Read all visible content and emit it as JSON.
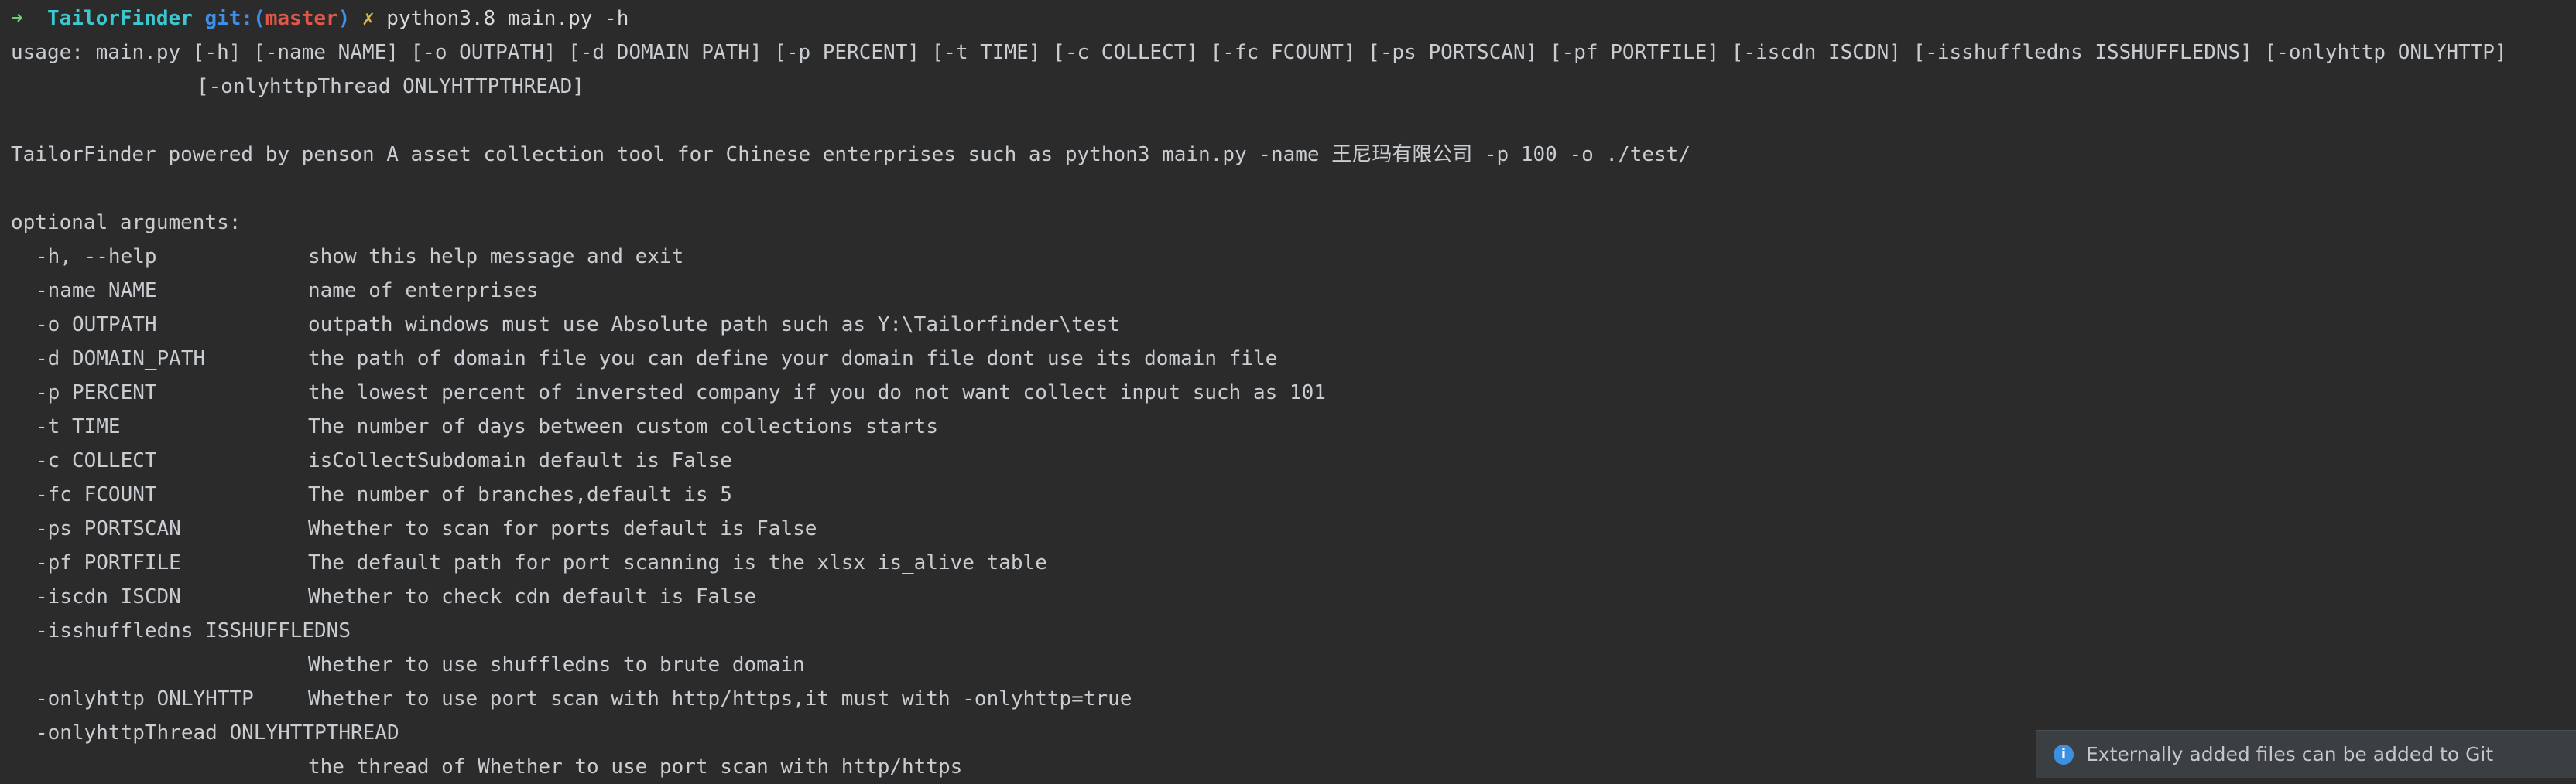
{
  "prompt": {
    "arrow": "➜",
    "directory": "TailorFinder",
    "git_label": "git:(",
    "branch": "master",
    "git_close": ")",
    "dirty_mark": "✗",
    "command": "python3.8 main.py -h"
  },
  "usage": {
    "line1": "usage: main.py [-h] [-name NAME] [-o OUTPATH] [-d DOMAIN_PATH] [-p PERCENT] [-t TIME] [-c COLLECT] [-fc FCOUNT] [-ps PORTSCAN] [-pf PORTFILE] [-iscdn ISCDN] [-isshuffledns ISSHUFFLEDNS] [-onlyhttp ONLYHTTP]",
    "line2": "[-onlyhttpThread ONLYHTTPTHREAD]"
  },
  "description": "TailorFinder powered by penson A asset collection tool for Chinese enterprises such as python3 main.py -name 王尼玛有限公司 -p 100 -o ./test/",
  "section_title": "optional arguments:",
  "options": [
    {
      "flag": "-h, --help",
      "desc": "show this help message and exit"
    },
    {
      "flag": "-name NAME",
      "desc": "name of enterprises"
    },
    {
      "flag": "-o OUTPATH",
      "desc": "outpath windows must use Absolute path such as Y:\\Tailorfinder\\test"
    },
    {
      "flag": "-d DOMAIN_PATH",
      "desc": "the path of domain file you can define your domain file dont use its domain file"
    },
    {
      "flag": "-p PERCENT",
      "desc": "the lowest percent of inversted company if you do not want collect input such as 101"
    },
    {
      "flag": "-t TIME",
      "desc": "The number of days between custom collections starts"
    },
    {
      "flag": "-c COLLECT",
      "desc": "isCollectSubdomain default is False"
    },
    {
      "flag": "-fc FCOUNT",
      "desc": "The number of branches,default is 5"
    },
    {
      "flag": "-ps PORTSCAN",
      "desc": "Whether to scan for ports default is False"
    },
    {
      "flag": "-pf PORTFILE",
      "desc": "The default path for port scanning is the xlsx is_alive table"
    },
    {
      "flag": "-iscdn ISCDN",
      "desc": "Whether to check cdn default is False"
    }
  ],
  "opt_isshuffledns": {
    "flag": "-isshuffledns ISSHUFFLEDNS",
    "desc": "Whether to use shuffledns to brute domain"
  },
  "opt_onlyhttp": {
    "flag": "-onlyhttp ONLYHTTP",
    "desc": "Whether to use port scan with http/https,it must with -onlyhttp=true"
  },
  "opt_onlyhttpthread": {
    "flag": "-onlyhttpThread ONLYHTTPTHREAD",
    "desc": "the thread of Whether to use port scan with http/https"
  },
  "notification": {
    "icon": "info-icon",
    "icon_glyph": "i",
    "text": "Externally added files can be added to Git",
    "icon_color": "#3d8fe0"
  }
}
